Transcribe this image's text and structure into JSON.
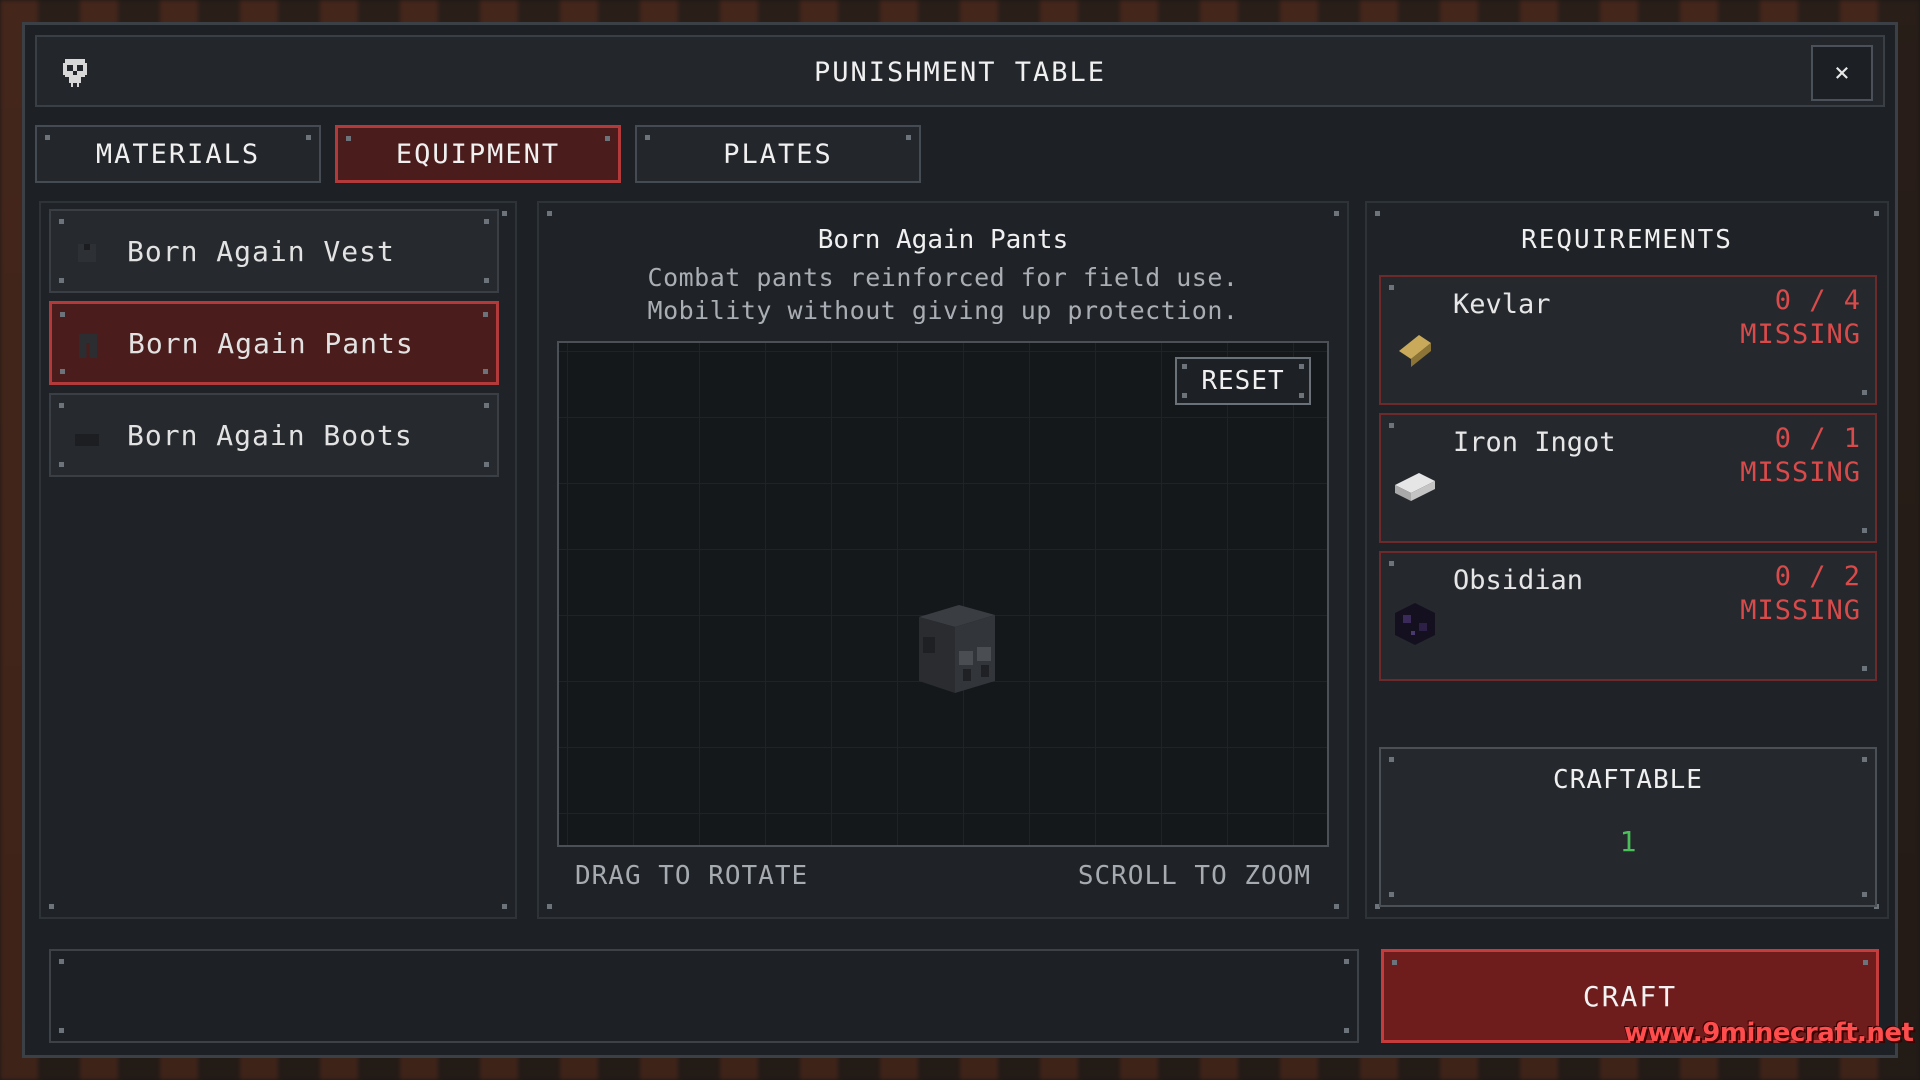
{
  "window": {
    "title": "PUNISHMENT TABLE",
    "close_label": "×"
  },
  "tabs": [
    {
      "label": "MATERIALS",
      "active": false
    },
    {
      "label": "EQUIPMENT",
      "active": true
    },
    {
      "label": "PLATES",
      "active": false
    }
  ],
  "equipment_list": [
    {
      "label": "Born Again Vest",
      "icon": "vest-icon",
      "selected": false
    },
    {
      "label": "Born Again Pants",
      "icon": "pants-icon",
      "selected": true
    },
    {
      "label": "Born Again Boots",
      "icon": "boots-icon",
      "selected": false
    }
  ],
  "preview": {
    "title": "Born Again Pants",
    "description_line1": "Combat pants reinforced for field use.",
    "description_line2": "Mobility without giving up protection.",
    "reset_label": "RESET",
    "hint_left": "DRAG TO ROTATE",
    "hint_right": "SCROLL TO ZOOM"
  },
  "requirements": {
    "title": "REQUIREMENTS",
    "items": [
      {
        "name": "Kevlar",
        "count": "0 / 4",
        "status": "MISSING",
        "icon": "kevlar-icon"
      },
      {
        "name": "Iron Ingot",
        "count": "0 / 1",
        "status": "MISSING",
        "icon": "iron-ingot-icon"
      },
      {
        "name": "Obsidian",
        "count": "0 / 2",
        "status": "MISSING",
        "icon": "obsidian-icon"
      }
    ],
    "craftable_label": "CRAFTABLE",
    "craftable_value": "1"
  },
  "craft_label": "CRAFT",
  "watermark": "www.9minecraft.net",
  "colors": {
    "accent_red": "#b33a3a",
    "missing_red": "#d94a4a",
    "craftable_green": "#4bbf5a"
  }
}
